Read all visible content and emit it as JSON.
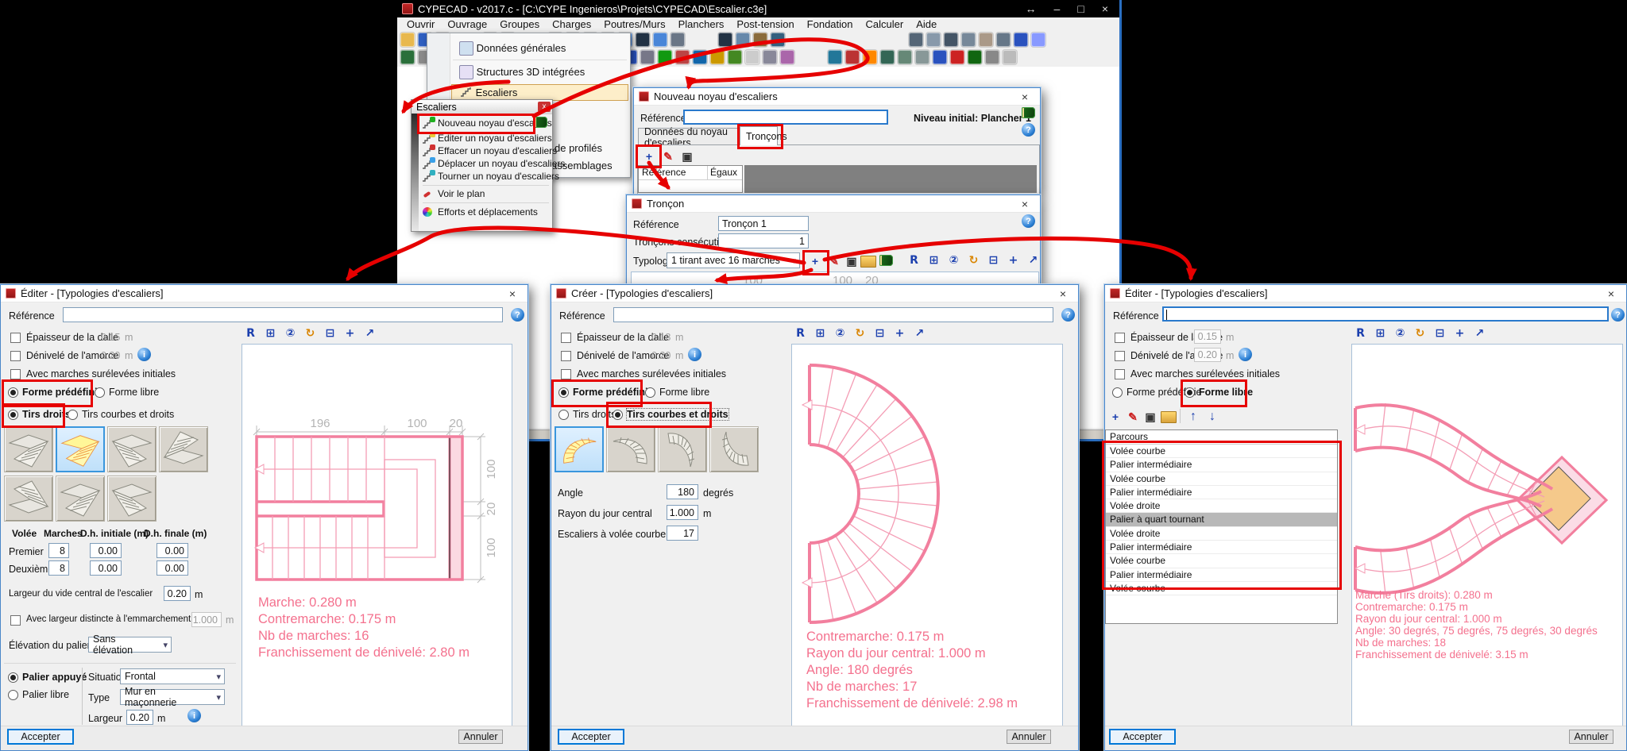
{
  "app": {
    "title": "CYPECAD - v2017.c - [C:\\CYPE Ingenieros\\Projets\\CYPECAD\\Escalier.c3e]",
    "menubar": [
      "Ouvrir",
      "Ouvrage",
      "Groupes",
      "Charges",
      "Poutres/Murs",
      "Planchers",
      "Post-tension",
      "Fondation",
      "Calculer",
      "Aide"
    ],
    "toolbar1": [
      "#e8b84e",
      "#2f5fc0",
      "#a8b0c0",
      "gap",
      "#d8dce6",
      "#8c94a6",
      "gap",
      "#2f5fc0",
      "#4a86d8",
      "#2a52be",
      "#d98500",
      "#4a86d8",
      "#223244",
      "#4a86d8",
      "#6a7686",
      "gap",
      "#223244",
      "#6688aa",
      "#8a6a3a",
      "#33607f",
      "gap",
      "gap",
      "gap",
      "gap",
      "#556677",
      "#8899aa",
      "#445566",
      "#778899",
      "#aa9988",
      "#667788",
      "#2a52be",
      "#8899ff"
    ],
    "toolbar2": [
      "#2a6f3a",
      "#8a8a8a",
      "#bb2222",
      "gap",
      "#caa21e",
      "#aa2222",
      "#d8d8d8",
      "#cc3333",
      "#117711",
      "#cc6622",
      "#33bb66",
      "#cc2233",
      "#2a52be",
      "#777788",
      "#119911",
      "#bb4444",
      "#1166aa",
      "#cc9900",
      "#448822",
      "#cccccc",
      "#888899",
      "#aa66aa",
      "gap",
      "#227799",
      "#bb3333",
      "#ff8800",
      "#336655",
      "#668877",
      "#889898",
      "#2a52be",
      "#cc2222",
      "#116611",
      "#888888",
      "#bbbbbb"
    ]
  },
  "icons": {
    "resize": "↔",
    "minimize": "–",
    "maximize": "□",
    "close": "×",
    "plus": "+",
    "pencil": "✎",
    "copy": "▣",
    "up": "↑",
    "down": "↓",
    "help": "?",
    "info": "i",
    "zoom_tools": [
      "R",
      "⊞",
      "②",
      "↻",
      "⊟",
      "+",
      "↗"
    ]
  },
  "ouvrage_menu": {
    "items": [
      "Données générales",
      "Structures 3D intégrées",
      "Escaliers"
    ],
    "fragments": [
      "de profilés",
      "assemblages"
    ]
  },
  "escaliers_panel": {
    "title": "Escaliers",
    "items": [
      "Nouveau noyau d'escaliers",
      "Éditer un noyau d'escaliers",
      "Effacer un noyau d'escaliers",
      "Déplacer un noyau d'escaliers",
      "Tourner un noyau d'escaliers",
      "Voir le plan",
      "Efforts et déplacements"
    ]
  },
  "nouveau_dialog": {
    "title": "Nouveau noyau d'escaliers",
    "reference_label": "Référence",
    "niveau_initial": "Niveau initial: Plancher 1",
    "tab1": "Données du noyau d'escaliers",
    "tab2": "Tronçons",
    "col_ref": "Référence",
    "col_egaux": "Égaux"
  },
  "troncon_dialog": {
    "title": "Tronçon",
    "reference_label": "Référence",
    "reference_value": "Tronçon 1",
    "consec_label": "Tronçons consécutifs égaux",
    "consec_value": "1",
    "typologie_label": "Typologie",
    "typologie_value": "1 tirant avec 16 marches",
    "dims": [
      "100",
      "100",
      "20"
    ]
  },
  "left_dialog": {
    "title": "Éditer - [Typologies d'escaliers]",
    "reference_label": "Référence",
    "epaisseur_label": "Épaisseur de la dalle",
    "epaisseur_value": "0.15",
    "denivele_label": "Dénivelé de l'amorce",
    "denivele_value": "0.20",
    "unit": "m",
    "marches_label": "Avec marches surélevées initiales",
    "forme_pre": "Forme prédéfinie",
    "forme_libre": "Forme libre",
    "tirs_droits": "Tirs droits",
    "tirs_courbes": "Tirs courbes et droits",
    "table_headers": [
      "Volée",
      "Marches",
      "D.h. initiale (m)",
      "D.h. finale (m)"
    ],
    "row1_label": "Premier",
    "row1": [
      "8",
      "0.00",
      "0.00"
    ],
    "row2_label": "Deuxième",
    "row2": [
      "8",
      "0.00",
      "0.00"
    ],
    "vide_label": "Largeur du vide central de l'escalier",
    "vide_value": "0.20",
    "emm_label": "Avec largeur distincte à l'emmarchement",
    "emm_value": "1.000",
    "elev_label": "Élévation du palier",
    "elev_value": "Sans élévation",
    "palier_appuye": "Palier appuyé",
    "palier_libre": "Palier libre",
    "situation_label": "Situation",
    "situation_value": "Frontal",
    "type_label": "Type",
    "type_value": "Mur en maçonnerie",
    "largeur_label": "Largeur",
    "largeur_value": "0.20",
    "dims_top": [
      "196",
      "100",
      "20"
    ],
    "dims_right": [
      "100",
      "20",
      "100"
    ],
    "preview_lines": [
      "Marche: 0.280 m",
      "Contremarche: 0.175 m",
      "Nb de marches: 16",
      "Franchissement de dénivelé: 2.80 m"
    ],
    "accept": "Accepter",
    "cancel": "Annuler"
  },
  "middle_dialog": {
    "title": "Créer - [Typologies d'escaliers]",
    "reference_label": "Référence",
    "epaisseur_label": "Épaisseur de la dalle",
    "epaisseur_value": "0.18",
    "denivele_label": "Dénivelé de l'amorce",
    "denivele_value": "0.20",
    "unit": "m",
    "marches_label": "Avec marches surélevées initiales",
    "forme_pre": "Forme prédéfinie",
    "forme_libre": "Forme libre",
    "tirs_droits": "Tirs droits",
    "tirs_courbes": "Tirs courbes et droits",
    "angle_label": "Angle",
    "angle_value": "180",
    "angle_unit": "degrés",
    "rayon_label": "Rayon du jour central",
    "rayon_value": "1.000",
    "rayon_unit": "m",
    "volee_label": "Escaliers à volée courbe",
    "volee_value": "17",
    "preview_lines": [
      "Contremarche: 0.175 m",
      "Rayon du jour central: 1.000 m",
      "Angle: 180 degrés",
      "Nb de marches: 17",
      "Franchissement de dénivelé: 2.98 m"
    ],
    "accept": "Accepter",
    "cancel": "Annuler"
  },
  "right_dialog": {
    "title": "Éditer - [Typologies d'escaliers]",
    "reference_label": "Référence",
    "epaisseur_label": "Épaisseur de la dalle",
    "epaisseur_value": "0.15",
    "denivele_label": "Dénivelé de l'amorce",
    "denivele_value": "0.20",
    "unit": "m",
    "marches_label": "Avec marches surélevées initiales",
    "forme_pre": "Forme prédéfinie",
    "forme_libre": "Forme libre",
    "parcours_header": "Parcours",
    "parcours_items": [
      "Volée courbe",
      "Palier intermédiaire",
      "Volée courbe",
      "Palier intermédiaire",
      "Volée droite",
      "Palier à quart tournant",
      "Volée droite",
      "Palier intermédiaire",
      "Volée courbe",
      "Palier intermédiaire",
      "Volée courbe"
    ],
    "preview_lines": [
      "Marche (Tirs droits): 0.280 m",
      "Contremarche: 0.175 m",
      "Rayon du jour central: 1.000 m",
      "Angle: 30 degrés, 75 degrés, 75 degrés, 30 degrés",
      "Nb de marches: 18",
      "Franchissement de dénivelé: 3.15 m"
    ],
    "accept": "Accepter",
    "cancel": "Annuler"
  }
}
